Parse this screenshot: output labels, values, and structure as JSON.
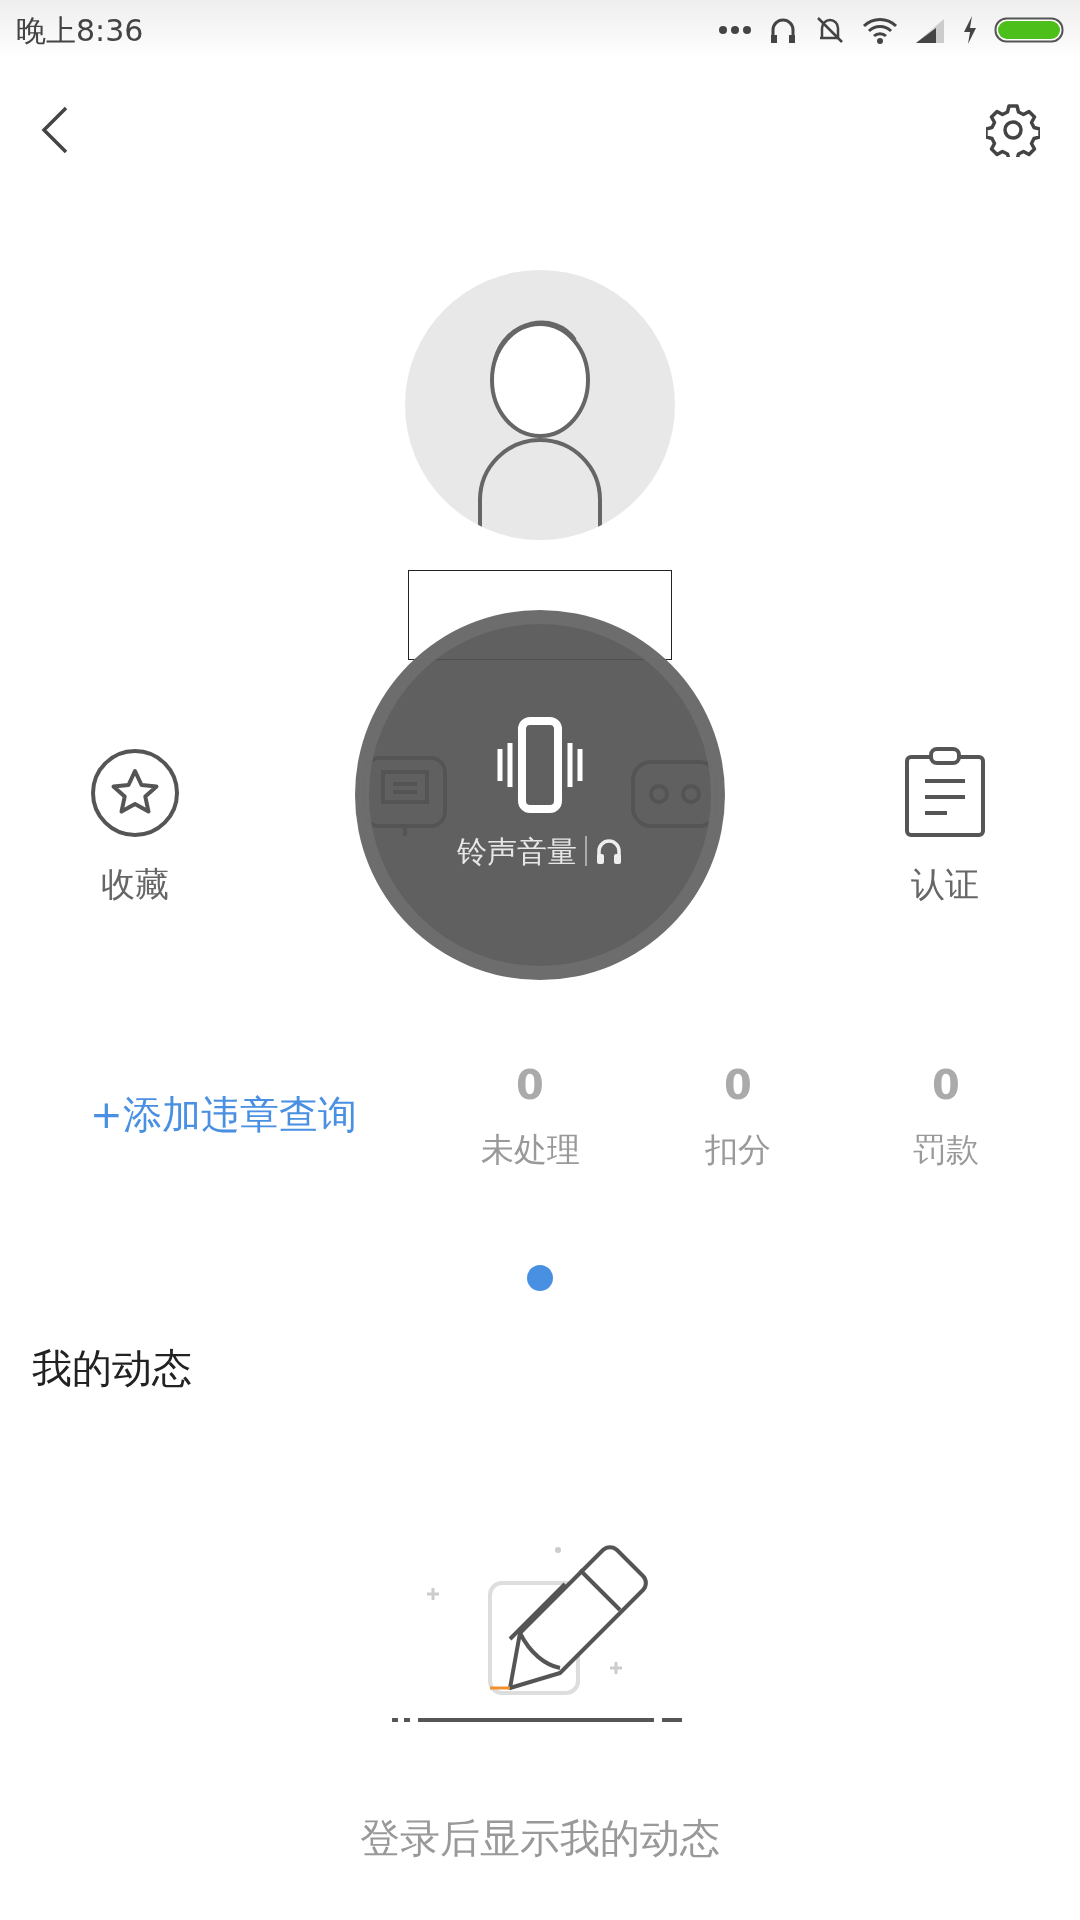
{
  "status_bar": {
    "time": "晚上8:36"
  },
  "shortcuts": [
    {
      "label": "收藏",
      "kind": "star"
    },
    {
      "kind": "message"
    },
    {
      "kind": "group"
    },
    {
      "label": "认证",
      "kind": "clipboard"
    }
  ],
  "violations": {
    "add_link": "+添加违章查询",
    "stats": [
      {
        "value": "0",
        "label": "未处理"
      },
      {
        "value": "0",
        "label": "扣分"
      },
      {
        "value": "0",
        "label": "罚款"
      }
    ]
  },
  "pager": [
    {
      "selected": true
    }
  ],
  "feed": {
    "title": "我的动态",
    "empty_text": "登录后显示我的动态"
  },
  "volume_popup": {
    "label": "铃声音量"
  }
}
